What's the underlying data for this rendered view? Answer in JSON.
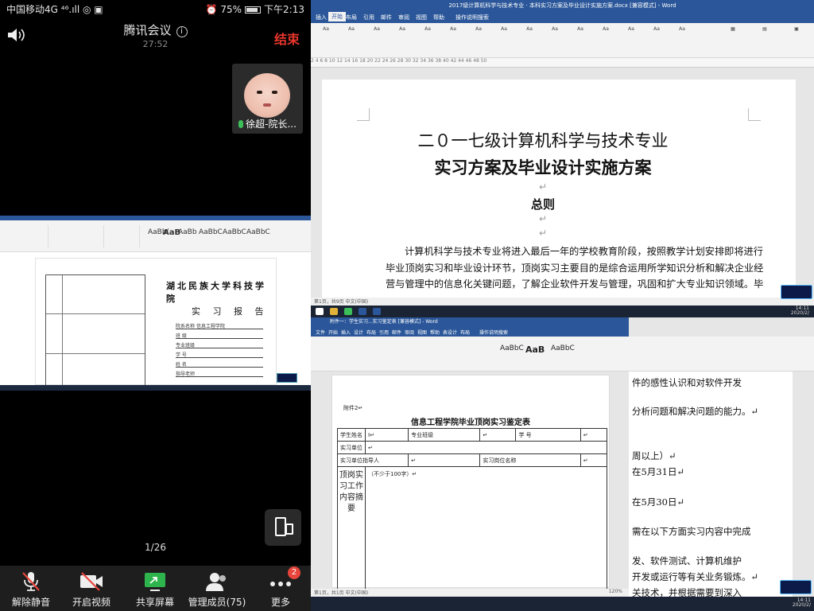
{
  "status_bar": {
    "carrier": "中国移动4G",
    "net": "⁴⁶.ıll",
    "battery": "75%",
    "time": "下午2:13"
  },
  "meeting": {
    "app_title": "腾讯会议",
    "duration": "27:52",
    "end_label": "结束"
  },
  "participant": {
    "name": "徐超-院长..."
  },
  "shared_doc": {
    "school": "湖北民族大学科技学院",
    "report": "实 习 报 告",
    "fields": [
      "院系名称",
      "班  级",
      "专业班级",
      "学  号",
      "姓  名",
      "指导老师"
    ],
    "field_value_0": "信息工程学院"
  },
  "page_indicator": "1/26",
  "toolbar": [
    {
      "label": "解除静音",
      "icon": "mic-muted-icon"
    },
    {
      "label": "开启视频",
      "icon": "video-off-icon"
    },
    {
      "label": "共享屏幕",
      "icon": "share-screen-icon"
    },
    {
      "label": "管理成员(75)",
      "icon": "members-icon"
    },
    {
      "label": "更多",
      "icon": "more-icon",
      "badge": "2"
    }
  ],
  "doc1": {
    "title": "2017级计算机科学与技术专业 · 本科实习方案及毕业设计实施方案.docx [兼容模式] - Word",
    "menu": [
      "文件",
      "开始",
      "插入",
      "设计",
      "布局",
      "引用",
      "邮件",
      "审阅",
      "视图",
      "帮助",
      "操作说明搜索"
    ],
    "heading1": "二０一七级计算机科学与技术专业",
    "heading2": "实习方案及毕业设计实施方案",
    "section": "总则",
    "para": "计算机科学与技术专业将进入最后一年的学校教育阶段，按照教学计划安排即将进行毕业顶岗实习和毕业设计环节，顶岗实习主要目的是综合运用所学知识分析和解决企业经营与管理中的信息化关键问题，了解企业软件开发与管理，巩固和扩大专业知识领域。毕",
    "status": "第1页，共9页    中文(中国)",
    "ruler": "2 4 6 8 10 12 14 16 18 20 22 24 26 28 30 32 34 36 38 40 42 44 46 48 50"
  },
  "doc1_cont": {
    "lines": [
      "件的感性认识和对软件开发",
      "分析问题和解决问题的能力。↵",
      "周以上）↵",
      "在5月31日↵",
      "在5月30日↵",
      "需在以下方面实习内容中完成",
      "发、软件测试、计算机维护",
      "开发或运行等有关业务锻炼。↵",
      "关技术，并根据需要到深入"
    ]
  },
  "doc2": {
    "title": "附件一：学生实习...实习鉴定表 [兼容模式] - Word",
    "menu": [
      "文件",
      "开始",
      "插入",
      "设计",
      "布局",
      "引用",
      "邮件",
      "审阅",
      "视图",
      "帮助",
      "表设计",
      "布局",
      "操作说明搜索"
    ],
    "attach": "附件2↵",
    "table_title": "信息工程学院毕业顶岗实习鉴定表",
    "row1": [
      "学生姓名",
      "I↵",
      "专业班级",
      "↵",
      "学 号",
      "↵"
    ],
    "row2": [
      "实习单位",
      "↵"
    ],
    "row3": [
      "实习单位指导人",
      "↵",
      "实习岗位名称",
      "↵"
    ],
    "vertical": "顶岗实习工作内容摘要",
    "hint": "（不少于100字）↵",
    "status": "第1页，共1页    中文(中国)",
    "zoom": "120%"
  },
  "clock": {
    "time": "14:11",
    "date": "2020/2/"
  }
}
